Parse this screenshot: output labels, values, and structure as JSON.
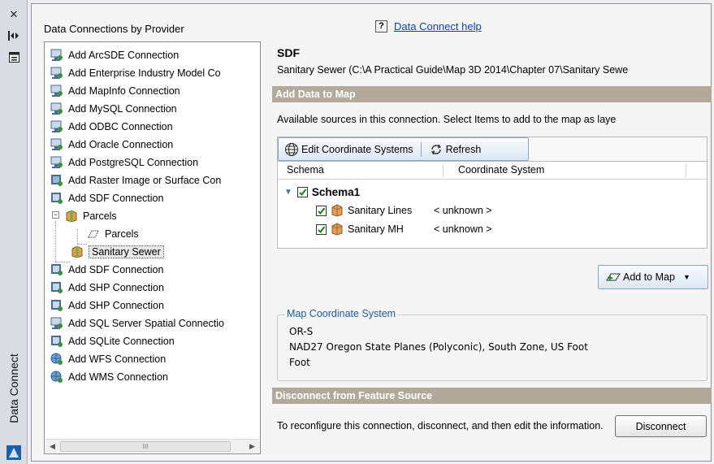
{
  "palette": {
    "title": "Data Connect"
  },
  "tree": {
    "header": "Data Connections by Provider",
    "items": [
      {
        "label": "Add ArcSDE Connection"
      },
      {
        "label": "Add Enterprise Industry Model Co"
      },
      {
        "label": "Add MapInfo Connection"
      },
      {
        "label": "Add MySQL Connection"
      },
      {
        "label": "Add ODBC Connection"
      },
      {
        "label": "Add Oracle Connection"
      },
      {
        "label": "Add PostgreSQL Connection"
      },
      {
        "label": "Add Raster Image or Surface Con"
      },
      {
        "label": "Add SDF Connection"
      },
      {
        "label": "Parcels"
      },
      {
        "label": "Parcels"
      },
      {
        "label": "Sanitary Sewer"
      },
      {
        "label": "Add SDF Connection"
      },
      {
        "label": "Add SHP Connection"
      },
      {
        "label": "Add SHP Connection"
      },
      {
        "label": "Add SQL Server Spatial Connectio"
      },
      {
        "label": "Add SQLite Connection"
      },
      {
        "label": "Add WFS Connection"
      },
      {
        "label": "Add WMS Connection"
      }
    ],
    "scroll_thumb": "III"
  },
  "help": {
    "icon_text": "?",
    "link": "Data Connect help"
  },
  "connection": {
    "type": "SDF",
    "path": "Sanitary Sewer (C:\\A Practical Guide\\Map 3D 2014\\Chapter 07\\Sanitary Sewe"
  },
  "add_data": {
    "section_title": "Add Data to Map",
    "description": "Available sources in this connection.  Select Items to add to the map as laye",
    "toolbar": {
      "edit_cs": "Edit Coordinate Systems",
      "refresh": "Refresh"
    },
    "grid": {
      "headers": [
        "Schema",
        "Coordinate System"
      ],
      "schema_name": "Schema1",
      "rows": [
        {
          "name": "Sanitary Lines",
          "cs": "< unknown >",
          "checked": true
        },
        {
          "name": "Sanitary MH",
          "cs": "< unknown >",
          "checked": true
        }
      ]
    },
    "add_button": "Add to Map"
  },
  "map_cs": {
    "legend": "Map Coordinate System",
    "code": "OR-S",
    "description": "NAD27 Oregon State Planes (Polyconic), South Zone, US Foot",
    "units": "Foot"
  },
  "disconnect": {
    "section_title": "Disconnect from Feature Source",
    "text": "To reconfigure this connection, disconnect, and then edit the information.",
    "button": "Disconnect"
  },
  "colors": {
    "section_bar": "#b3a99a",
    "link": "#0645ad",
    "legend": "#1e5a9c"
  }
}
